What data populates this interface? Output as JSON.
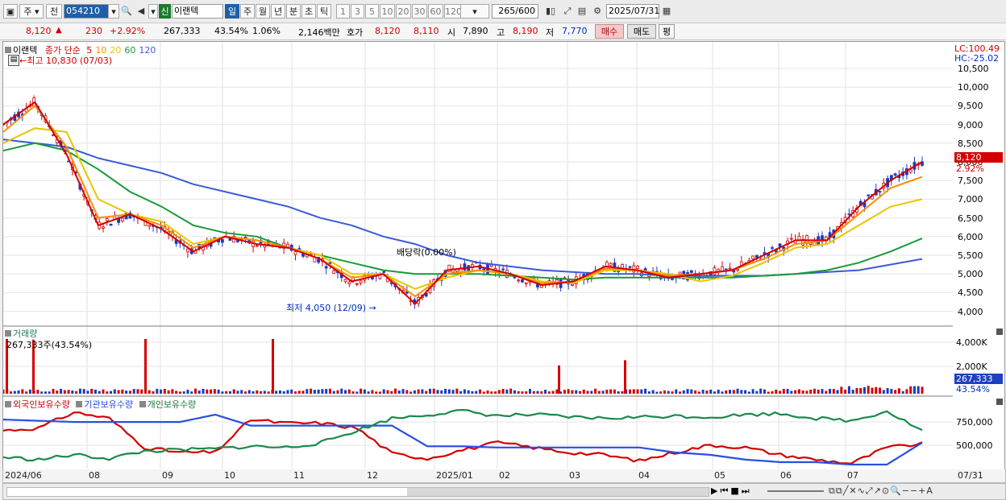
{
  "toolbar": {
    "market_tab": "주",
    "scope_tab": "전",
    "code": "054210",
    "credit_badge": "신",
    "stock_name": "이랜텍",
    "periods": [
      "일",
      "주",
      "월",
      "년",
      "분",
      "초",
      "틱"
    ],
    "active_period": "일",
    "intervals": [
      "1",
      "3",
      "5",
      "10",
      "20",
      "30",
      "60",
      "120"
    ],
    "count": "265",
    "count_total": "/600",
    "date": "2025/07/31"
  },
  "quote": {
    "price": "8,120",
    "change": "230",
    "change_pct": "+2.92%",
    "volume": "267,333",
    "volume_ratio": "43.54%",
    "turnover": "1.06%",
    "amount": "2,146백만",
    "bid_label": "호가",
    "ask_price": "8,120",
    "bid_price": "8,110",
    "open_label": "시",
    "open": "7,890",
    "high_label": "고",
    "high": "8,190",
    "low_label": "저",
    "low": "7,770",
    "buy_button": "매수",
    "sell_button": "매도",
    "eval_button": "평"
  },
  "price_panel": {
    "legend_name": "이랜텍",
    "legend_ma": "종가 단순",
    "ma_periods": [
      "5",
      "10",
      "20",
      "60",
      "120"
    ],
    "ma_colors": [
      "#d40000",
      "#ff8c00",
      "#e6c700",
      "#1a9a3a",
      "#3a5ad8"
    ],
    "high_annotation": "최고 10,830 (07/03)",
    "low_annotation": "최저 4,050 (12/09)",
    "dividend_annotation": "배당락(0.00%)",
    "lc": "LC:100.49",
    "hc": "HC:-25.02",
    "y_ticks": [
      "10,500",
      "10,000",
      "9,500",
      "9,000",
      "8,500",
      "8,000",
      "7,500",
      "7,000",
      "6,500",
      "6,000",
      "5,500",
      "5,000",
      "4,500",
      "4,000"
    ],
    "last_price_tag": "8,120",
    "last_pct_tag": "2.92%"
  },
  "volume_panel": {
    "title": "거래량",
    "value": "267,333주(43.54%)",
    "y_ticks": [
      "4,000K",
      "2,000K"
    ],
    "last_tag": "267,333",
    "last_pct": "43.54%"
  },
  "holder_panel": {
    "legends": [
      "외국인보유수량",
      "기관보유수량",
      "개인보유수량"
    ],
    "y_ticks": [
      "750,000",
      "500,000"
    ]
  },
  "x_axis": {
    "labels": [
      "2024/06",
      "08",
      "09",
      "10",
      "11",
      "12",
      "2025/01",
      "02",
      "03",
      "04",
      "05",
      "06",
      "07"
    ],
    "end_label": "07/31"
  },
  "chart_data": [
    {
      "type": "line",
      "title": "이랜텍",
      "x_range": [
        "2024/06",
        "2025/07/31"
      ],
      "y_range": [
        4000,
        10500
      ],
      "annotations": [
        {
          "text": "최고 10,830 (07/03)",
          "date": "2024/07/03",
          "value": 10830
        },
        {
          "text": "최저 4,050 (12/09)",
          "date": "2024/12/09",
          "value": 4050
        },
        {
          "text": "배당락(0.00%)",
          "date": "2024/12/27"
        }
      ],
      "series": [
        {
          "name": "5",
          "values": [
            9000,
            9600,
            8200,
            6300,
            6600,
            6200,
            5600,
            6000,
            5800,
            5700,
            5400,
            4800,
            5000,
            4200,
            5100,
            5200,
            5000,
            4700,
            4800,
            5200,
            5100,
            4900,
            5000,
            5100,
            5500,
            5900,
            5900,
            6800,
            7500,
            8000
          ]
        },
        {
          "name": "10",
          "values": [
            8800,
            9500,
            8400,
            6500,
            6600,
            6300,
            5700,
            6000,
            5900,
            5700,
            5400,
            4900,
            5000,
            4400,
            5000,
            5100,
            5000,
            4750,
            4800,
            5150,
            5100,
            4950,
            5000,
            5100,
            5400,
            5800,
            5900,
            6600,
            7300,
            7600
          ]
        },
        {
          "name": "20",
          "values": [
            8500,
            8900,
            8800,
            7000,
            6600,
            6400,
            5800,
            6000,
            5900,
            5700,
            5500,
            5000,
            5000,
            4600,
            4900,
            5100,
            5000,
            4800,
            4750,
            5100,
            5100,
            5000,
            4800,
            4950,
            5300,
            5700,
            5800,
            6300,
            6800,
            7000
          ]
        },
        {
          "name": "60",
          "values": [
            8300,
            8500,
            8300,
            7800,
            7200,
            6800,
            6300,
            6100,
            6000,
            5700,
            5500,
            5300,
            5100,
            5000,
            5000,
            5000,
            4950,
            4900,
            4850,
            4900,
            4900,
            4900,
            4900,
            4900,
            4950,
            5000,
            5100,
            5300,
            5600,
            5950
          ]
        },
        {
          "name": "120",
          "values": [
            8600,
            8500,
            8400,
            8100,
            7900,
            7700,
            7400,
            7200,
            7000,
            6800,
            6500,
            6300,
            6000,
            5800,
            5500,
            5300,
            5200,
            5100,
            5050,
            5000,
            5000,
            4950,
            4950,
            4950,
            4950,
            5000,
            5050,
            5100,
            5250,
            5400
          ]
        }
      ]
    },
    {
      "type": "bar",
      "title": "거래량",
      "y_range": [
        0,
        4000000
      ],
      "spikes": [
        {
          "date": "2024/08",
          "value": 4800000
        },
        {
          "date": "2024/11",
          "value": 4300000
        },
        {
          "date": "2025/03",
          "value": 2200000
        },
        {
          "date": "2025/04",
          "value": 2600000
        }
      ],
      "last": {
        "value": 267333,
        "label": "267,333",
        "pct": "43.54%"
      }
    },
    {
      "type": "line",
      "title": "보유수량",
      "y_range": [
        400000,
        850000
      ],
      "series": [
        {
          "name": "외국인보유수량",
          "values": [
            700000,
            720000,
            850000,
            800000,
            560000,
            520000,
            520000,
            790000,
            760000,
            760000,
            720000,
            510000,
            470000,
            540000,
            600000,
            560000,
            520000,
            500000,
            450000,
            520000,
            580000,
            560000,
            500000,
            460000,
            430000,
            560000,
            590000
          ]
        },
        {
          "name": "기관보유수량",
          "values": [
            790000,
            780000,
            770000,
            770000,
            770000,
            770000,
            830000,
            740000,
            740000,
            740000,
            740000,
            740000,
            570000,
            570000,
            560000,
            560000,
            560000,
            560000,
            560000,
            520000,
            500000,
            460000,
            440000,
            440000,
            420000,
            420000,
            600000
          ]
        },
        {
          "name": "개인보유수량",
          "values": [
            480000,
            460000,
            500000,
            470000,
            530000,
            540000,
            550000,
            570000,
            560000,
            600000,
            700000,
            800000,
            830000,
            860000,
            820000,
            830000,
            810000,
            800000,
            810000,
            820000,
            810000,
            830000,
            840000,
            800000,
            780000,
            860000,
            700000
          ]
        }
      ]
    }
  ]
}
